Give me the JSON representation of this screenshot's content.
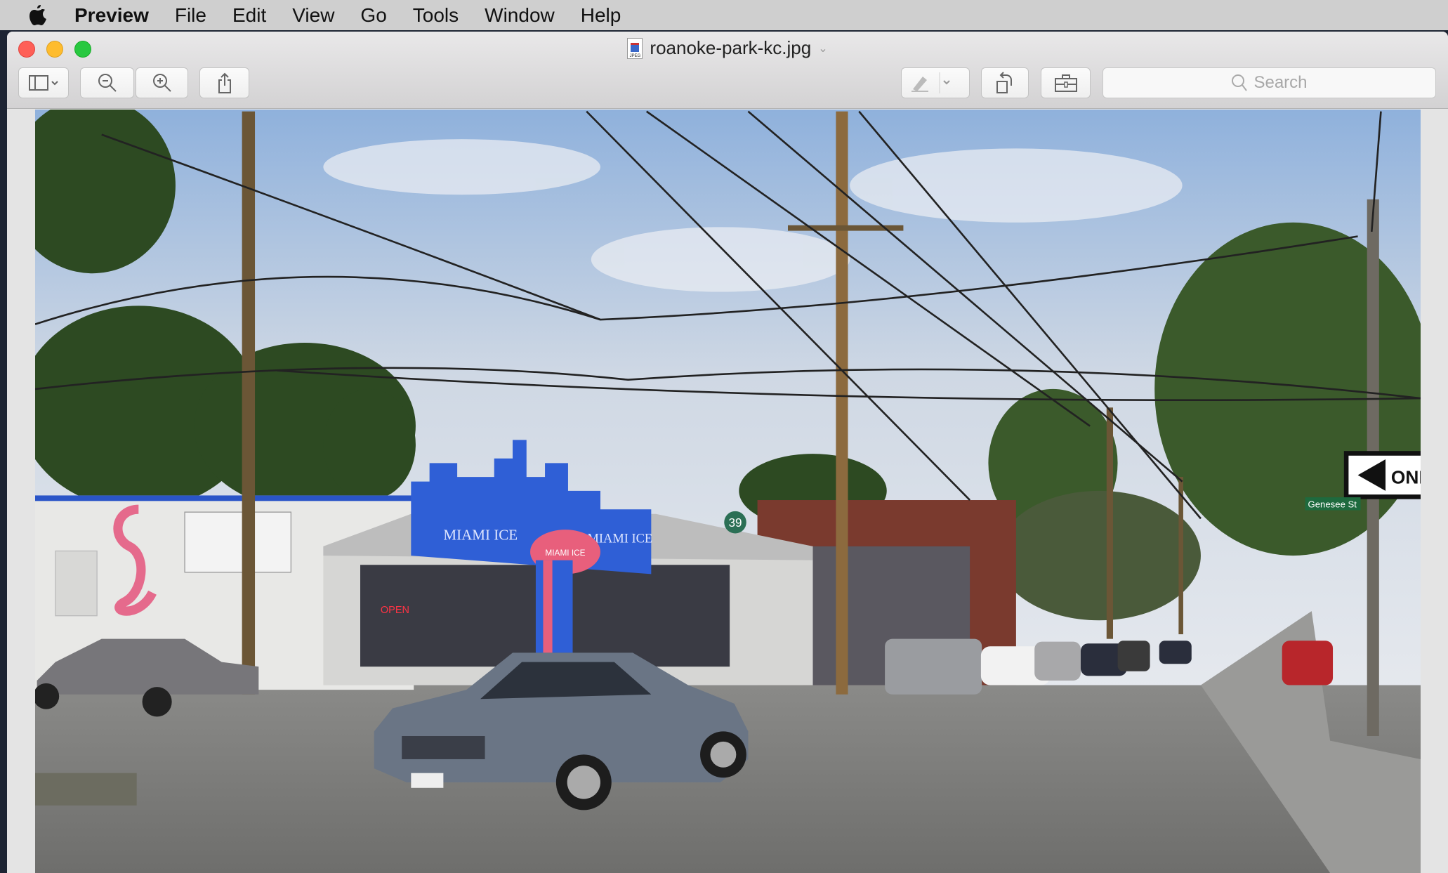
{
  "menubar": {
    "app": "Preview",
    "items": [
      "File",
      "Edit",
      "View",
      "Go",
      "Tools",
      "Window",
      "Help"
    ]
  },
  "window": {
    "title": "roanoke-park-kc.jpg",
    "file_type_badge": "JPEG"
  },
  "toolbar": {
    "search_placeholder": "Search"
  },
  "photo": {
    "sign_text": "MIAMI ICE",
    "sign_text_2": "MIAMI ICE",
    "logo_text": "MIAMI ICE",
    "route_badge": "39",
    "one_way": "ONE",
    "street_sign": "Genesee St",
    "open_sign": "OPEN"
  },
  "colors": {
    "close": "#fe5f57",
    "minimize": "#febc2e",
    "zoom": "#28c840",
    "sign_blue": "#2f5fd6"
  }
}
